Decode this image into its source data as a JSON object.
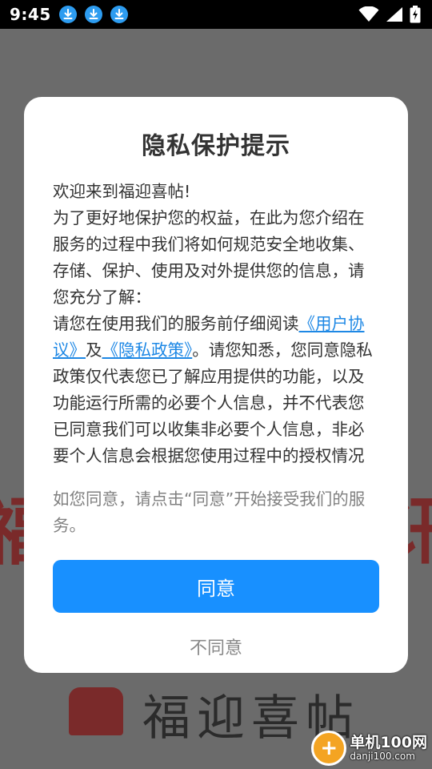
{
  "status_bar": {
    "time": "9:45"
  },
  "background": {
    "left_glyph": "福",
    "right_glyph": "讯",
    "app_title": "福迎喜帖"
  },
  "dialog": {
    "title": "隐私保护提示",
    "body_p1": "欢迎来到福迎喜帖!",
    "body_p2": "为了更好地保护您的权益，在此为您介绍在服务的过程中我们将如何规范安全地收集、存储、保护、使用及对外提供您的信息，请您充分了解：",
    "body_p3_prefix": "请您在使用我们的服务前仔细阅读",
    "user_agreement_link": "《用户协议》",
    "body_p3_and": "及",
    "privacy_policy_link": "《隐私政策》",
    "body_p3_suffix": "。请您知悉，您同意隐私政策仅代表您已了解应用提供的功能，以及功能运行所需的必要个人信息，并不代表您已同意我们可以收集非必要个人信息，非必要个人信息会根据您使用过程中的授权情况单独征求",
    "note": "如您同意，请点击“同意”开始接受我们的服务。",
    "agree_label": "同意",
    "disagree_label": "不同意"
  },
  "watermark": {
    "main": "单机100网",
    "url": "danji100.com"
  },
  "colors": {
    "accent": "#1890ff",
    "link": "#1e88e5",
    "status_bar_bg": "#000000",
    "download_badge": "#2d9cf0"
  },
  "icons": [
    "download-icon",
    "wifi-icon",
    "signal-icon",
    "battery-icon"
  ]
}
